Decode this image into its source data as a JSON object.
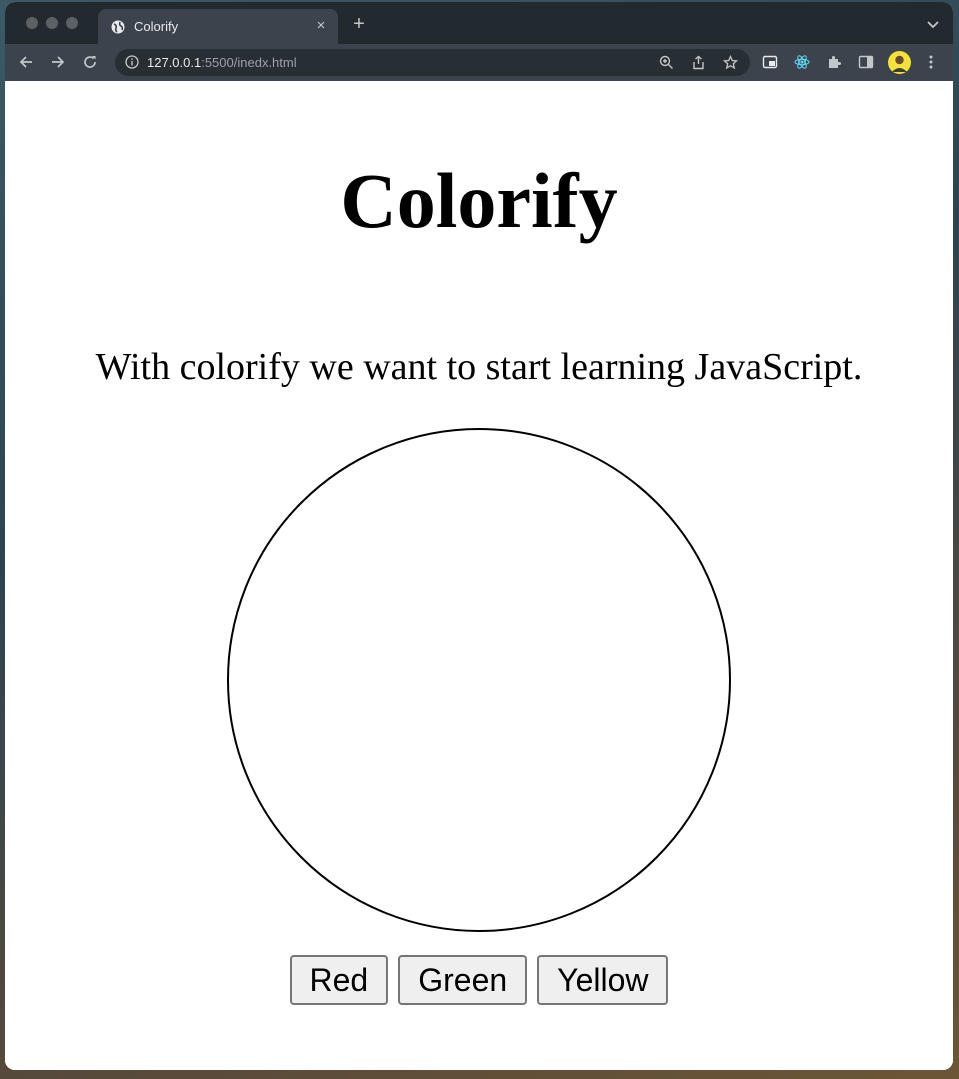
{
  "browser": {
    "tab_title": "Colorify",
    "new_tab_symbol": "+",
    "close_symbol": "×",
    "url_host": "127.0.0.1",
    "url_rest": ":5500/inedx.html"
  },
  "page": {
    "heading": "Colorify",
    "intro": "With colorify we want to start learning JavaScript.",
    "circle_color": "#ffffff",
    "buttons": {
      "red": "Red",
      "green": "Green",
      "yellow": "Yellow"
    }
  },
  "icons": [
    "globe-icon",
    "close-icon",
    "plus-icon",
    "chevron-down-icon",
    "back-icon",
    "forward-icon",
    "reload-icon",
    "info-icon",
    "zoom-icon",
    "share-icon",
    "star-icon",
    "picture-in-picture-icon",
    "react-icon",
    "extensions-icon",
    "side-panel-icon",
    "avatar",
    "more-icon"
  ]
}
